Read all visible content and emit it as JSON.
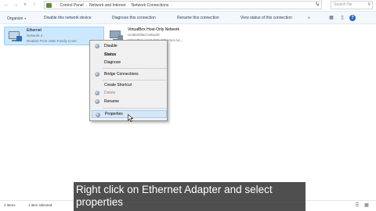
{
  "address": {
    "crumbs": [
      "Control Panel",
      "Network and Internet",
      "Network Connections"
    ],
    "search_placeholder": "Search Ne"
  },
  "toolbar": {
    "organize": "Organize",
    "disable": "Disable this network device",
    "diagnose": "Diagnose this connection",
    "rename": "Rename this connection",
    "view_status": "View status of this connection"
  },
  "adapters": [
    {
      "name": "Ethernet",
      "status": "Network 4",
      "device": "Realtek PCIe GBE Family Contr"
    },
    {
      "name": "VirtualBox Host-Only Network",
      "status": "Unidentified network",
      "device": "VirtualBox Host-Only Ethernet Ad..."
    }
  ],
  "context_menu": {
    "items": [
      "Disable",
      "Status",
      "Diagnose",
      "Bridge Connections",
      "Create Shortcut",
      "Delete",
      "Rename",
      "Properties"
    ]
  },
  "statusbar": {
    "count": "2 items",
    "selected": "1 item selected"
  },
  "caption": {
    "text": "Right click on Ethernet Adapter and select properties"
  },
  "colors": {
    "selection": "#cce8ff",
    "menu_hover": "#d6e8f8",
    "caption_bg": "#282828"
  }
}
